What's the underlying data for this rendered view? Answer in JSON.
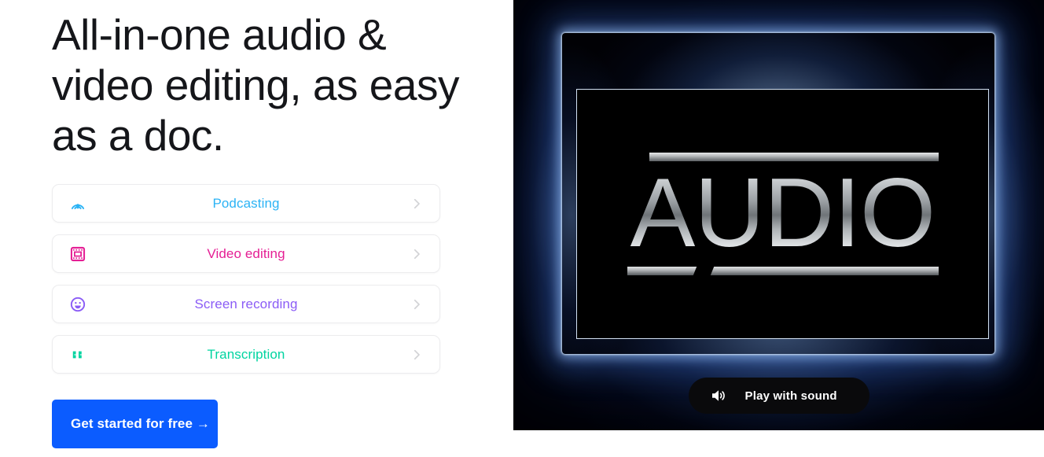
{
  "hero": {
    "headline": "All-in-one audio & video editing, as easy as a doc.",
    "cta_label": "Get started for free →",
    "cta_color": "#0b5cff"
  },
  "features": [
    {
      "label": "Podcasting",
      "color": "#2bb3f5",
      "icon": "broadcast-icon",
      "chevron": "chevron-right-icon"
    },
    {
      "label": "Video editing",
      "color": "#e51e94",
      "icon": "film-strip-icon",
      "chevron": "chevron-right-icon"
    },
    {
      "label": "Screen recording",
      "color": "#8b5cf6",
      "icon": "smiley-face-icon",
      "chevron": "chevron-right-icon"
    },
    {
      "label": "Transcription",
      "color": "#00d4a0",
      "icon": "quote-marks-icon",
      "chevron": "chevron-right-icon"
    }
  ],
  "video": {
    "screen_text": "AUDIO",
    "play_label": "Play with sound",
    "play_icon": "speaker-icon",
    "glow_color": "#7eb6ff",
    "background_color": "#010104"
  }
}
